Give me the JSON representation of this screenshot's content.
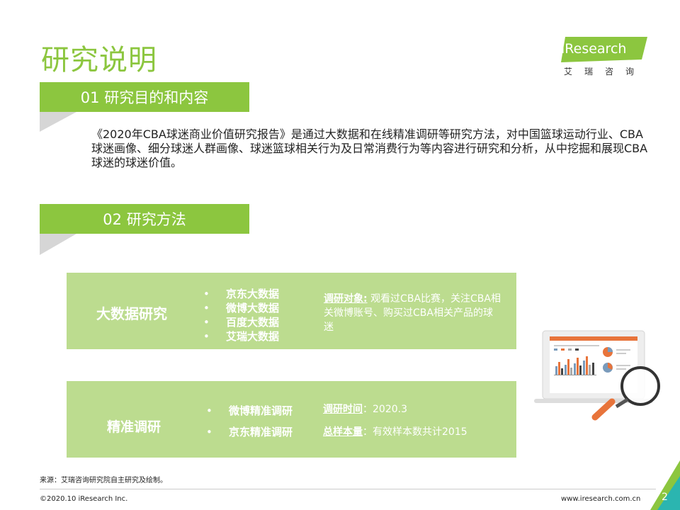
{
  "page": {
    "title": "研究说明"
  },
  "logo": {
    "brand": "iResearch",
    "cn_name": "艾瑞咨询"
  },
  "sections": [
    {
      "heading": "01 研究目的和内容",
      "body": "《2020年CBA球迷商业价值研究报告》是通过大数据和在线精准调研等研究方法，对中国篮球运动行业、CBA球迷画像、细分球迷人群画像、球迷篮球相关行为及日常消费行为等内容进行研究和分析，从中挖掘和展现CBA球迷的球迷价值。"
    },
    {
      "heading": "02 研究方法"
    }
  ],
  "methods": {
    "big_data": {
      "title": "大数据研究",
      "items": [
        "京东大数据",
        "微博大数据",
        "百度大数据",
        "艾瑞大数据"
      ],
      "object_label": "调研对象:",
      "object_text": "观看过CBA比赛，关注CBA相关微博账号、购买过CBA相关产品的球迷"
    },
    "precise": {
      "title": "精准调研",
      "items": [
        "微博精准调研",
        "京东精准调研"
      ],
      "time_label": "调研时间",
      "time_value": "：2020.3",
      "sample_label": "总样本量",
      "sample_value": "：有效样本数共计2015"
    }
  },
  "footer": {
    "source": "来源：艾瑞咨询研究院自主研究及绘制。",
    "copyright": "©2020.10 iResearch Inc.",
    "website": "www.iresearch.com.cn",
    "page_number": "2"
  },
  "colors": {
    "accent_green": "#8cc63f",
    "light_green": "#bcdc8f",
    "magnifier_orange": "#e8743b"
  }
}
